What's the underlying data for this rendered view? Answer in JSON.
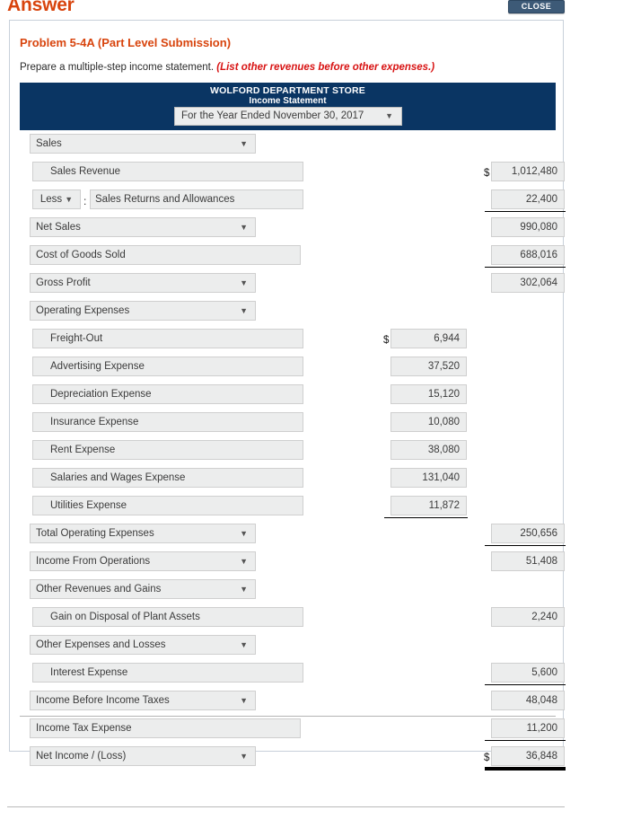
{
  "header": {
    "answer_label": "Answer",
    "close_label": "CLOSE"
  },
  "problem": {
    "title": "Problem 5-4A (Part Level Submission)",
    "instruction": "Prepare a multiple-step income statement.",
    "hint": "(List other revenues before other expenses.)"
  },
  "statement": {
    "company": "WOLFORD DEPARTMENT STORE",
    "title": "Income Statement",
    "period_selected": "For the Year Ended November 30, 2017",
    "caret": "▼",
    "colon": ":",
    "dollar": "$"
  },
  "rows": [
    {
      "label": "Sales",
      "kind": "select",
      "mid": "",
      "right": ""
    },
    {
      "label": "Sales Revenue",
      "kind": "text-indent",
      "mid": "",
      "right": "1,012,480",
      "right_dollar": true
    },
    {
      "label": "Sales Returns and Allowances",
      "kind": "less",
      "less_label": "Less",
      "mid": "",
      "right": "22,400",
      "right_rule": true
    },
    {
      "label": "Net Sales",
      "kind": "select",
      "mid": "",
      "right": "990,080"
    },
    {
      "label": "Cost of Goods Sold",
      "kind": "text",
      "mid": "",
      "right": "688,016",
      "right_rule": true
    },
    {
      "label": "Gross Profit",
      "kind": "select",
      "mid": "",
      "right": "302,064"
    },
    {
      "label": "Operating Expenses",
      "kind": "select",
      "mid": "",
      "right": ""
    },
    {
      "label": "Freight-Out",
      "kind": "text-indent",
      "mid": "6,944",
      "mid_dollar": true,
      "right": ""
    },
    {
      "label": "Advertising Expense",
      "kind": "text-indent",
      "mid": "37,520",
      "right": ""
    },
    {
      "label": "Depreciation Expense",
      "kind": "text-indent",
      "mid": "15,120",
      "right": ""
    },
    {
      "label": "Insurance Expense",
      "kind": "text-indent",
      "mid": "10,080",
      "right": ""
    },
    {
      "label": "Rent Expense",
      "kind": "text-indent",
      "mid": "38,080",
      "right": ""
    },
    {
      "label": "Salaries and Wages Expense",
      "kind": "text-indent",
      "mid": "131,040",
      "right": ""
    },
    {
      "label": "Utilities Expense",
      "kind": "text-indent",
      "mid": "11,872",
      "right": "",
      "mid_rule": true
    },
    {
      "label": "Total Operating Expenses",
      "kind": "select",
      "mid": "",
      "right": "250,656",
      "right_rule": true
    },
    {
      "label": "Income From Operations",
      "kind": "select",
      "mid": "",
      "right": "51,408"
    },
    {
      "label": "Other Revenues and Gains",
      "kind": "select",
      "mid": "",
      "right": ""
    },
    {
      "label": "Gain on Disposal of Plant Assets",
      "kind": "text-indent",
      "mid": "",
      "right": "2,240"
    },
    {
      "label": "Other Expenses and Losses",
      "kind": "select",
      "mid": "",
      "right": ""
    },
    {
      "label": "Interest Expense",
      "kind": "text-indent",
      "mid": "",
      "right": "5,600",
      "right_rule": true
    },
    {
      "label": "Income Before Income Taxes",
      "kind": "select",
      "mid": "",
      "right": "48,048"
    },
    {
      "label": "Income Tax Expense",
      "kind": "text",
      "mid": "",
      "right": "11,200",
      "right_rule": true
    },
    {
      "label": "Net Income / (Loss)",
      "kind": "select",
      "mid": "",
      "right": "36,848",
      "right_dollar": true,
      "right_rule_double": true
    }
  ]
}
